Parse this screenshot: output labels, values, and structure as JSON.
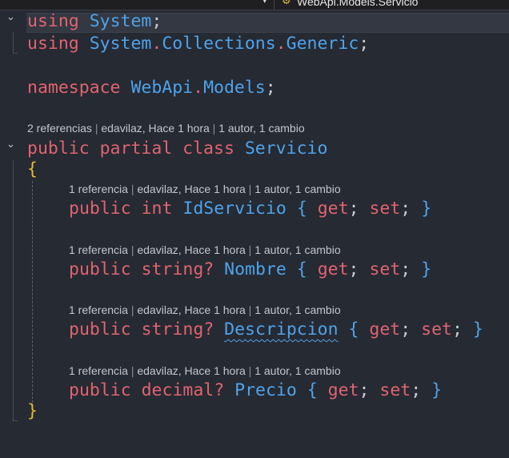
{
  "tab": {
    "title": "WebApi.Models.Servicio"
  },
  "code_lines": [
    [
      {
        "t": "using",
        "c": "kw"
      },
      {
        "t": " "
      },
      {
        "t": "System",
        "c": "type"
      },
      {
        "t": ";",
        "c": "punc"
      }
    ],
    [
      {
        "t": "using",
        "c": "kw"
      },
      {
        "t": " "
      },
      {
        "t": "System",
        "c": "type"
      },
      {
        "t": ".",
        "c": "kw"
      },
      {
        "t": "Collections",
        "c": "type"
      },
      {
        "t": ".",
        "c": "kw"
      },
      {
        "t": "Generic",
        "c": "type"
      },
      {
        "t": ";",
        "c": "punc"
      }
    ],
    [
      {
        "t": "namespace",
        "c": "kw"
      },
      {
        "t": " "
      },
      {
        "t": "WebApi",
        "c": "type"
      },
      {
        "t": ".",
        "c": "kw"
      },
      {
        "t": "Models",
        "c": "type"
      },
      {
        "t": ";",
        "c": "punc"
      }
    ],
    [
      {
        "t": "public partial class",
        "c": "kw"
      },
      {
        "t": " "
      },
      {
        "t": "Servicio",
        "c": "type"
      }
    ],
    [
      {
        "t": "{",
        "c": "brace"
      }
    ],
    [
      {
        "t": "public int",
        "c": "kw"
      },
      {
        "t": " "
      },
      {
        "t": "IdServicio",
        "c": "type"
      },
      {
        "t": " "
      },
      {
        "t": "{",
        "c": "pbrace"
      },
      {
        "t": " "
      },
      {
        "t": "get",
        "c": "kw"
      },
      {
        "t": "; ",
        "c": "punc"
      },
      {
        "t": "set",
        "c": "kw"
      },
      {
        "t": "; ",
        "c": "punc"
      },
      {
        "t": "}",
        "c": "pbrace"
      }
    ],
    [
      {
        "t": "public string?",
        "c": "kw"
      },
      {
        "t": " "
      },
      {
        "t": "Nombre",
        "c": "type"
      },
      {
        "t": " "
      },
      {
        "t": "{",
        "c": "pbrace"
      },
      {
        "t": " "
      },
      {
        "t": "get",
        "c": "kw"
      },
      {
        "t": "; ",
        "c": "punc"
      },
      {
        "t": "set",
        "c": "kw"
      },
      {
        "t": "; ",
        "c": "punc"
      },
      {
        "t": "}",
        "c": "pbrace"
      }
    ],
    [
      {
        "t": "public string?",
        "c": "kw"
      },
      {
        "t": " "
      },
      {
        "t": "Descripcion",
        "c": "type squig"
      },
      {
        "t": " "
      },
      {
        "t": "{",
        "c": "pbrace"
      },
      {
        "t": " "
      },
      {
        "t": "get",
        "c": "kw"
      },
      {
        "t": "; ",
        "c": "punc"
      },
      {
        "t": "set",
        "c": "kw"
      },
      {
        "t": "; ",
        "c": "punc"
      },
      {
        "t": "}",
        "c": "pbrace"
      }
    ],
    [
      {
        "t": "public decimal?",
        "c": "kw"
      },
      {
        "t": " "
      },
      {
        "t": "Precio",
        "c": "type"
      },
      {
        "t": " "
      },
      {
        "t": "{",
        "c": "pbrace"
      },
      {
        "t": " "
      },
      {
        "t": "get",
        "c": "kw"
      },
      {
        "t": "; ",
        "c": "punc"
      },
      {
        "t": "set",
        "c": "kw"
      },
      {
        "t": "; ",
        "c": "punc"
      },
      {
        "t": "}",
        "c": "pbrace"
      }
    ],
    [
      {
        "t": "}",
        "c": "brace"
      }
    ]
  ],
  "codelens": [
    [
      "2 referencias",
      "edavilaz, Hace 1 hora",
      "1 autor, 1 cambio"
    ],
    [
      "1 referencia",
      "edavilaz, Hace 1 hora",
      "1 autor, 1 cambio"
    ],
    [
      "1 referencia",
      "edavilaz, Hace 1 hora",
      "1 autor, 1 cambio"
    ],
    [
      "1 referencia",
      "edavilaz, Hace 1 hora",
      "1 autor, 1 cambio"
    ],
    [
      "1 referencia",
      "edavilaz, Hace 1 hora",
      "1 autor, 1 cambio"
    ]
  ],
  "lens_separator": " | ",
  "icons": {
    "fold": "⌄",
    "dropdown": "▾",
    "class_icon": "⚙"
  }
}
